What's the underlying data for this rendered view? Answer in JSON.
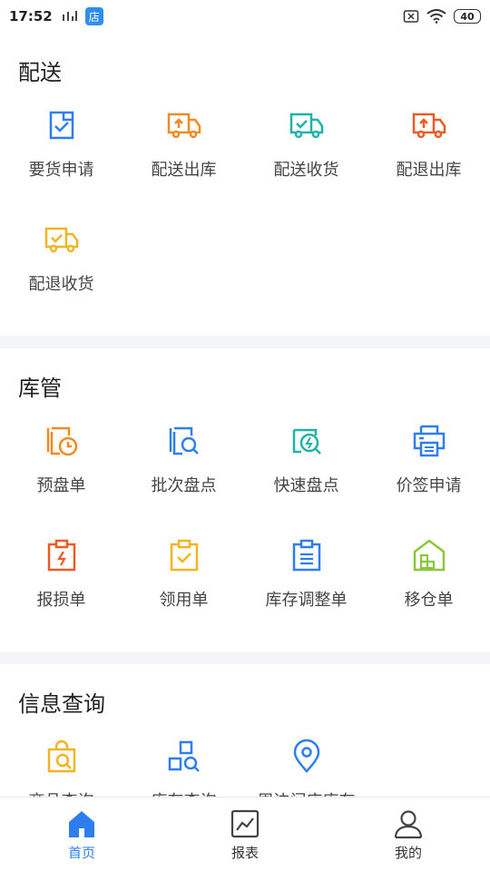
{
  "status": {
    "time": "17:52",
    "store_badge": "店",
    "battery": "40"
  },
  "sections": [
    {
      "title": "配送",
      "items": [
        {
          "label": "要货申请",
          "icon": "doc-check-icon"
        },
        {
          "label": "配送出库",
          "icon": "truck-up-icon"
        },
        {
          "label": "配送收货",
          "icon": "truck-check-icon"
        },
        {
          "label": "配退出库",
          "icon": "truck-up-icon"
        },
        {
          "label": "配退收货",
          "icon": "truck-check-icon"
        }
      ]
    },
    {
      "title": "库管",
      "items": [
        {
          "label": "预盘单",
          "icon": "stack-clock-icon"
        },
        {
          "label": "批次盘点",
          "icon": "stack-search-icon"
        },
        {
          "label": "快速盘点",
          "icon": "search-bolt-icon"
        },
        {
          "label": "价签申请",
          "icon": "printer-icon"
        },
        {
          "label": "报损单",
          "icon": "clipboard-bolt-icon"
        },
        {
          "label": "领用单",
          "icon": "clipboard-check-icon"
        },
        {
          "label": "库存调整单",
          "icon": "clipboard-list-icon"
        },
        {
          "label": "移仓单",
          "icon": "warehouse-icon"
        }
      ]
    },
    {
      "title": "信息查询",
      "items": [
        {
          "label": "商品查询",
          "icon": "bag-search-icon"
        },
        {
          "label": "库存查询",
          "icon": "shapes-search-icon"
        },
        {
          "label": "周边门店库存",
          "icon": "location-pin-icon"
        }
      ]
    }
  ],
  "tabs": [
    {
      "label": "首页",
      "icon": "home-icon"
    },
    {
      "label": "报表",
      "icon": "chart-icon"
    },
    {
      "label": "我的",
      "icon": "user-icon"
    }
  ],
  "colors": {
    "blue": "#2f7ef0",
    "orange": "#f08a24",
    "teal": "#1fb3a6",
    "red": "#ee5a24",
    "yellow": "#f0b424",
    "green": "#8cc63f"
  }
}
